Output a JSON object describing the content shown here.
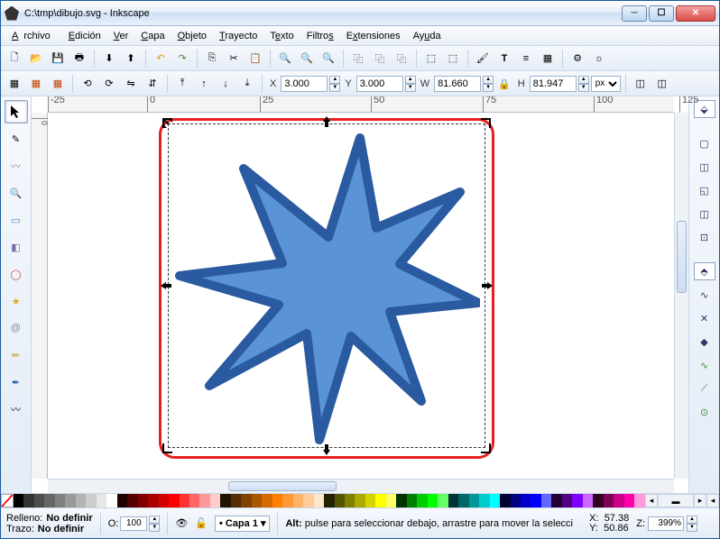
{
  "window": {
    "title": "C:\\tmp\\dibujo.svg - Inkscape"
  },
  "menu": {
    "archivo": "Archivo",
    "edicion": "Edición",
    "ver": "Ver",
    "capa": "Capa",
    "objeto": "Objeto",
    "trayecto": "Trayecto",
    "texto": "Texto",
    "filtros": "Filtros",
    "extensiones": "Extensiones",
    "ayuda": "Ayuda"
  },
  "coords_toolbar": {
    "x_label": "X",
    "x": "3.000",
    "y_label": "Y",
    "y": "3.000",
    "w_label": "W",
    "w": "81.660",
    "h_label": "H",
    "h": "81.947",
    "unit": "px"
  },
  "ruler_h": {
    "t0": "-25",
    "t1": "0",
    "t2": "25",
    "t3": "50",
    "t4": "75",
    "t5": "100",
    "t6": "125"
  },
  "ruler_v": {
    "t0": "0"
  },
  "status": {
    "relleno_label": "Relleno:",
    "relleno_val": "No definir",
    "trazo_label": "Trazo:",
    "trazo_val": "No definir",
    "o_label": "O:",
    "o_val": "100",
    "layer": "Capa 1",
    "hint_prefix": "Alt:",
    "hint": " pulse para seleccionar debajo, arrastre para mover la selecci",
    "x_label": "X:",
    "x_val": "57.38",
    "y_label": "Y:",
    "y_val": "50.86",
    "z_label": "Z:",
    "z_val": "399%"
  },
  "palette": [
    "#000000",
    "#333333",
    "#4d4d4d",
    "#666666",
    "#808080",
    "#999999",
    "#b3b3b3",
    "#cccccc",
    "#e6e6e6",
    "#ffffff",
    "#220000",
    "#550000",
    "#800000",
    "#aa0000",
    "#d40000",
    "#ff0000",
    "#ff3333",
    "#ff6666",
    "#ff9999",
    "#ffcccc",
    "#221100",
    "#552b00",
    "#804000",
    "#aa5500",
    "#d46a00",
    "#ff8000",
    "#ff9933",
    "#ffb366",
    "#ffcc99",
    "#ffe6cc",
    "#222200",
    "#555500",
    "#808000",
    "#aaaa00",
    "#d4d400",
    "#ffff00",
    "#ffff66",
    "#003300",
    "#008000",
    "#00cc00",
    "#00ff00",
    "#66ff66",
    "#003333",
    "#006666",
    "#009999",
    "#00cccc",
    "#00ffff",
    "#000033",
    "#000080",
    "#0000cc",
    "#0000ff",
    "#6666ff",
    "#220033",
    "#550080",
    "#8000ff",
    "#cc66ff",
    "#330022",
    "#800055",
    "#cc0088",
    "#ff00aa",
    "#ff99dd"
  ]
}
